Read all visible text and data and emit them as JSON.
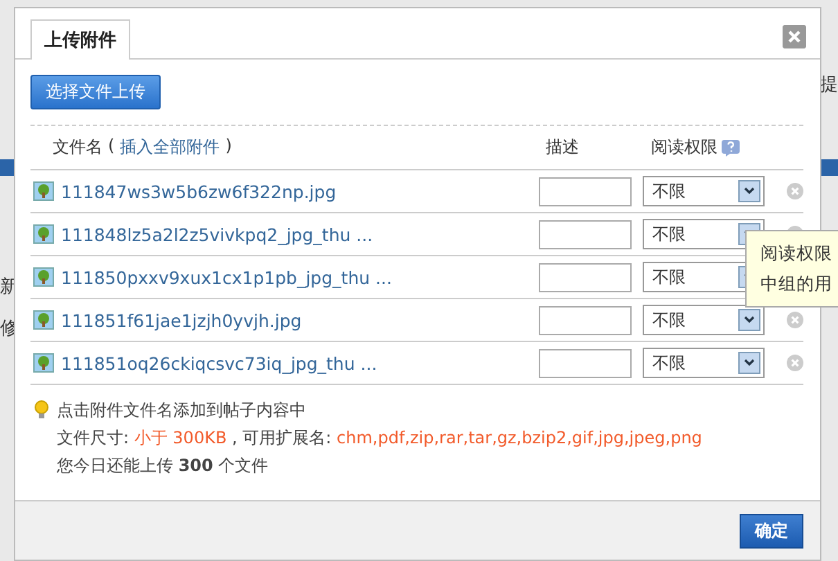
{
  "background": {
    "left_fragments": [
      "新",
      "修"
    ],
    "right_fragments": [
      "提"
    ]
  },
  "dialog": {
    "tab": {
      "label": "上传附件",
      "selected": true
    },
    "upload_button": "选择文件上传",
    "columns": {
      "filename": "文件名",
      "open_paren": "(",
      "insert_all_link": "插入全部附件",
      "close_paren": ")",
      "description": "描述",
      "permission": "阅读权限"
    },
    "files": [
      {
        "name": "111847ws3w5b6zw6f322np.jpg",
        "permission": "不限"
      },
      {
        "name": "111848lz5a2l2z5vivkpq2_jpg_thu ...",
        "permission": "不限"
      },
      {
        "name": "111850pxxv9xux1cx1p1pb_jpg_thu ...",
        "permission": "不限"
      },
      {
        "name": "111851f61jae1jzjh0yvjh.jpg",
        "permission": "不限"
      },
      {
        "name": "111851oq26ckiqcsvc73iq_jpg_thu ...",
        "permission": "不限"
      }
    ],
    "tips": {
      "hint": "点击附件文件名添加到帖子内容中",
      "size_line": [
        {
          "text": "文件尺寸: ",
          "kind": "plain"
        },
        {
          "text": "小于 300KB",
          "kind": "highlight"
        },
        {
          "text": " , 可用扩展名: ",
          "kind": "plain"
        },
        {
          "text": "chm,pdf,zip,rar,tar,gz,bzip2,gif,jpg,jpeg,png",
          "kind": "highlight"
        }
      ],
      "quota": "您今日还能上传 **300** 个文件"
    },
    "tooltip": [
      "阅读权限",
      "中组的用"
    ],
    "confirm_button": "确定"
  }
}
